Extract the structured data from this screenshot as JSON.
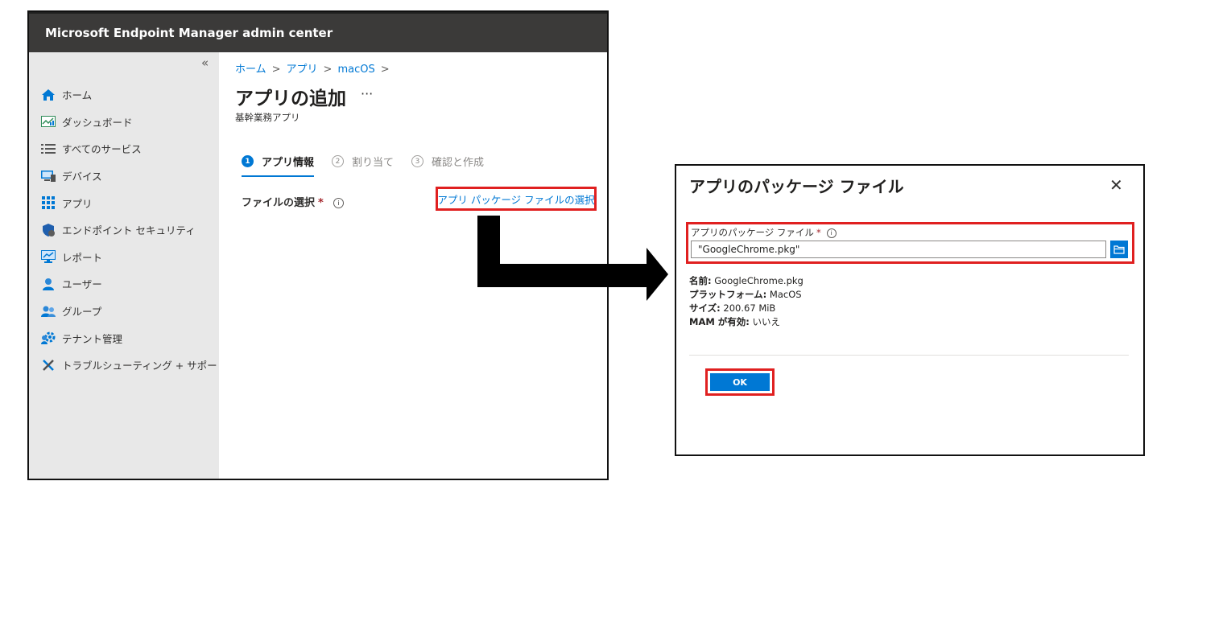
{
  "portal": {
    "app_title": "Microsoft Endpoint Manager admin center",
    "collapse_glyph": "«",
    "sidebar": {
      "items": [
        {
          "label": "ホーム",
          "icon": "home-icon"
        },
        {
          "label": "ダッシュボード",
          "icon": "dashboard-icon"
        },
        {
          "label": "すべてのサービス",
          "icon": "list-icon"
        },
        {
          "label": "デバイス",
          "icon": "device-icon"
        },
        {
          "label": "アプリ",
          "icon": "apps-grid-icon"
        },
        {
          "label": "エンドポイント セキュリティ",
          "icon": "shield-icon"
        },
        {
          "label": "レポート",
          "icon": "report-icon"
        },
        {
          "label": "ユーザー",
          "icon": "user-icon"
        },
        {
          "label": "グループ",
          "icon": "group-icon"
        },
        {
          "label": "テナント管理",
          "icon": "tenant-gear-icon"
        },
        {
          "label": "トラブルシューティング + サポート",
          "icon": "tools-icon"
        }
      ]
    },
    "breadcrumb": [
      "ホーム",
      "アプリ",
      "macOS"
    ],
    "breadcrumb_sep": ">",
    "page_title": "アプリの追加",
    "more_glyph": "···",
    "page_subtitle": "基幹業務アプリ",
    "steps": [
      {
        "num": "1",
        "label": "アプリ情報",
        "active": true
      },
      {
        "num": "2",
        "label": "割り当て",
        "active": false
      },
      {
        "num": "3",
        "label": "確認と作成",
        "active": false
      }
    ],
    "file_label": "ファイルの選択",
    "required_mark": "*",
    "info_glyph": "i",
    "select_link": "アプリ パッケージ ファイルの選択"
  },
  "dialog": {
    "title": "アプリのパッケージ ファイル",
    "close_glyph": "✕",
    "field_label": "アプリのパッケージ ファイル",
    "required_mark": "*",
    "info_glyph": "i",
    "field_value": "\"GoogleChrome.pkg\"",
    "meta": {
      "name_label": "名前:",
      "name_value": "GoogleChrome.pkg",
      "platform_label": "プラットフォーム:",
      "platform_value": "MacOS",
      "size_label": "サイズ:",
      "size_value": "200.67 MiB",
      "mam_label": "MAM が有効:",
      "mam_value": "いいえ"
    },
    "ok_label": "OK"
  },
  "colors": {
    "accent": "#0078d4",
    "highlight": "#e02020",
    "topbar": "#3b3a39",
    "sidebar": "#e8e8e8"
  }
}
